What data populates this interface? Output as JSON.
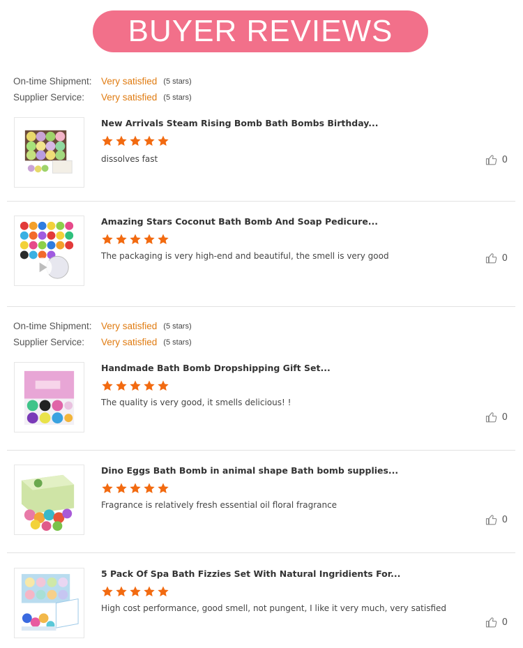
{
  "banner": {
    "title": "BUYER REVIEWS"
  },
  "rating_groups": [
    {
      "rows": [
        {
          "label": "On-time Shipment:",
          "value": "Very satisfied",
          "stars": "(5 stars)"
        },
        {
          "label": "Supplier Service:",
          "value": "Very satisfied",
          "stars": "(5 stars)"
        }
      ]
    },
    {
      "rows": [
        {
          "label": "On-time Shipment:",
          "value": "Very satisfied",
          "stars": "(5 stars)"
        },
        {
          "label": "Supplier Service:",
          "value": "Very satisfied",
          "stars": "(5 stars)"
        }
      ]
    }
  ],
  "reviews": [
    {
      "title": "New Arrivals Steam Rising Bomb Bath Bombs Birthday...",
      "rating": 5,
      "text": "dissolves fast",
      "likes": "0"
    },
    {
      "title": "Amazing Stars Coconut Bath Bomb And Soap Pedicure...",
      "rating": 5,
      "text": "The packaging is very high-end and beautiful, the smell is very good",
      "likes": "0"
    },
    {
      "title": "Handmade Bath Bomb Dropshipping Gift Set...",
      "rating": 5,
      "text": "The quality is very good, it smells delicious! !",
      "likes": "0"
    },
    {
      "title": "Dino Eggs Bath Bomb in animal shape Bath bomb supplies...",
      "rating": 5,
      "text": "Fragrance is relatively fresh essential oil floral fragrance",
      "likes": "0"
    },
    {
      "title": "5 Pack Of Spa Bath Fizzies Set With Natural Ingridients For...",
      "rating": 5,
      "text": "High cost performance, good smell, not pungent, I like it very much, very satisfied",
      "likes": "0"
    }
  ],
  "colors": {
    "banner": "#f2708a",
    "star": "#f26a10",
    "satisfied": "#e07b10"
  },
  "icons": {
    "star": "star-icon",
    "like": "thumbs-up-icon"
  }
}
